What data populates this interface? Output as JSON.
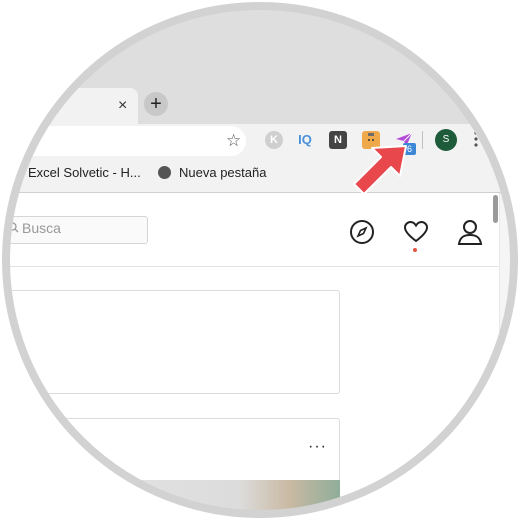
{
  "browser": {
    "tab_close": "×",
    "new_tab": "+",
    "toolbar": {
      "bookmark_star": "☆",
      "extensions": [
        {
          "name": "k-extension-icon",
          "label": "K"
        },
        {
          "name": "iq-extension-icon",
          "label": "IQ"
        },
        {
          "name": "n-extension-icon",
          "label": "N"
        },
        {
          "name": "box-extension-icon",
          "label": ""
        },
        {
          "name": "paper-plane-extension-icon",
          "label": "",
          "badge": "6"
        }
      ],
      "avatar": "S",
      "menu": "⋮"
    },
    "bookmarks": [
      {
        "label": "Excel Solvetic - H..."
      },
      {
        "label": "Nueva pestaña"
      }
    ]
  },
  "page": {
    "search_placeholder": "Busca",
    "card_menu": "···"
  },
  "colors": {
    "arrow": "#e8474c",
    "badge": "#3d88d6",
    "avatar": "#1e5b3a",
    "notification_dot": "#e0553e"
  }
}
